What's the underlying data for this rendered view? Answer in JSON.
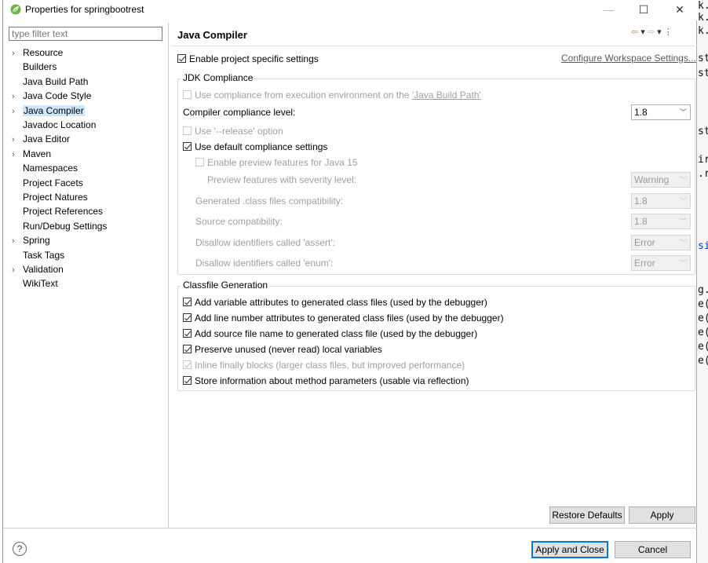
{
  "window": {
    "title": "Properties for springbootrest",
    "minimize": "—",
    "maximize": "☐",
    "close": "✕"
  },
  "sidebar": {
    "filter_placeholder": "type filter text",
    "items": [
      {
        "label": "Resource",
        "expandable": true
      },
      {
        "label": "Builders",
        "expandable": false
      },
      {
        "label": "Java Build Path",
        "expandable": false
      },
      {
        "label": "Java Code Style",
        "expandable": true
      },
      {
        "label": "Java Compiler",
        "expandable": true,
        "selected": true
      },
      {
        "label": "Javadoc Location",
        "expandable": false
      },
      {
        "label": "Java Editor",
        "expandable": true
      },
      {
        "label": "Maven",
        "expandable": true
      },
      {
        "label": "Namespaces",
        "expandable": false
      },
      {
        "label": "Project Facets",
        "expandable": false
      },
      {
        "label": "Project Natures",
        "expandable": false
      },
      {
        "label": "Project References",
        "expandable": false
      },
      {
        "label": "Run/Debug Settings",
        "expandable": false
      },
      {
        "label": "Spring",
        "expandable": true
      },
      {
        "label": "Task Tags",
        "expandable": false
      },
      {
        "label": "Validation",
        "expandable": true
      },
      {
        "label": "WikiText",
        "expandable": false
      }
    ]
  },
  "page": {
    "title": "Java Compiler",
    "enable_project_specific": "Enable project specific settings",
    "configure_workspace": "Configure Workspace Settings...",
    "jdk_group": "JDK Compliance",
    "use_compliance_prefix": "Use compliance from execution environment on the ",
    "use_compliance_link": "'Java Build Path'",
    "compliance_level_label": "Compiler compliance level:",
    "compliance_level_value": "1.8",
    "use_release": "Use '--release' option",
    "use_default": "Use default compliance settings",
    "enable_preview": "Enable preview features for Java 15",
    "preview_severity_label": "Preview features with severity level:",
    "preview_severity_value": "Warning",
    "generated_compat_label": "Generated .class files compatibility:",
    "generated_compat_value": "1.8",
    "source_compat_label": "Source compatibility:",
    "source_compat_value": "1.8",
    "assert_label": "Disallow identifiers called 'assert':",
    "assert_value": "Error",
    "enum_label": "Disallow identifiers called 'enum':",
    "enum_value": "Error",
    "classfile_group": "Classfile Generation",
    "cf_variable": "Add variable attributes to generated class files (used by the debugger)",
    "cf_line": "Add line number attributes to generated class files (used by the debugger)",
    "cf_source": "Add source file name to generated class file (used by the debugger)",
    "cf_preserve": "Preserve unused (never read) local variables",
    "cf_inline": "Inline finally blocks (larger class files, but improved performance)",
    "cf_store": "Store information about method parameters (usable via reflection)"
  },
  "buttons": {
    "restore_defaults": "Restore Defaults",
    "apply": "Apply",
    "apply_and_close": "Apply and Close",
    "cancel": "Cancel",
    "help": "?"
  },
  "background_editor": [
    "k.",
    "k.",
    "k.",
    "st",
    "st",
    "st",
    "ir",
    ".r",
    "si",
    "g.",
    "e(",
    "e(",
    "e(",
    "e(",
    "e("
  ],
  "colors": {
    "selection": "#cce8ff",
    "default_button_border": "#0078d7"
  }
}
